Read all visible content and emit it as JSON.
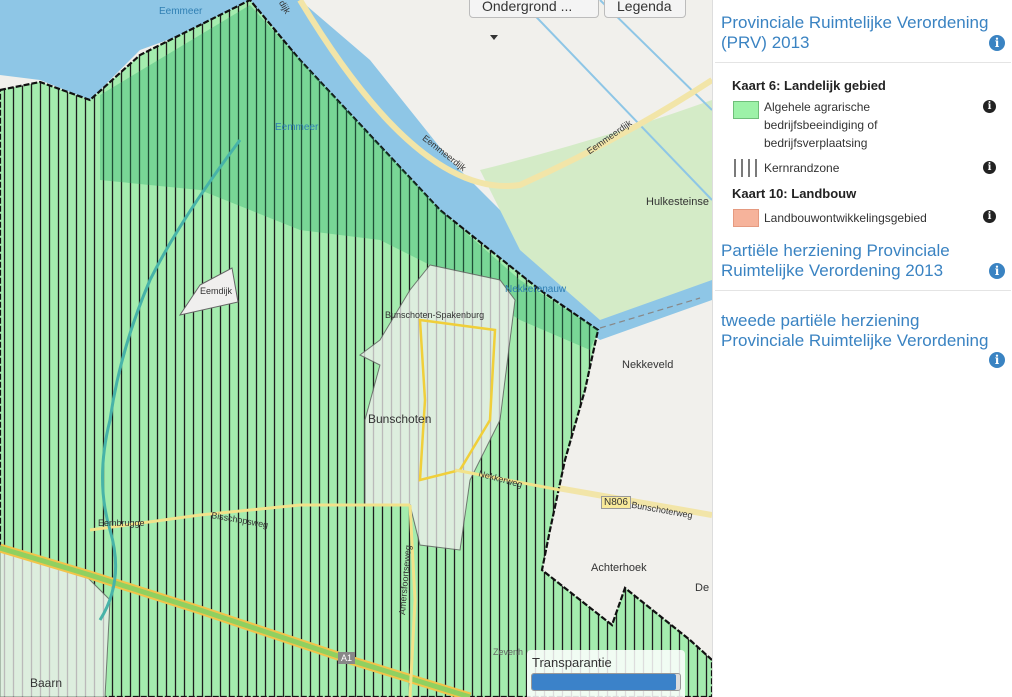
{
  "map": {
    "ondergrond_button": "Ondergrond ...",
    "legenda_button": "Legenda",
    "transparency_label": "Transparantie",
    "transparency_value": 0.97,
    "labels": {
      "eemmeer_top": "Eemmeer",
      "eemmeer_mid": "Eemmeer",
      "eemmeerdijk_a": "Eemmeerdijk",
      "eemmeerdijk_b": "Eemmeerdijk",
      "dijk": "dijk",
      "hulkesteinse": "Hulkesteinse",
      "nekkerkanaal": "Nekkerenauw",
      "nekkeveld": "Nekkeveld",
      "bunschoten_spakenburg": "Bunschoten-Spakenburg",
      "bunschoten": "Bunschoten",
      "nekkerweg": "Nekkerweg",
      "n806": "N806",
      "bunschoterweg": "Bunschoterweg",
      "bisschopsweg": "Bisschopsweg",
      "eemdijk": "Eemdijk",
      "eembrugge": "Eembrugge",
      "amersfoortseweg": "Amersfoortseweg",
      "achterhoek": "Achterhoek",
      "de": "De",
      "baarn": "Baarn",
      "a1": "A1",
      "zevenh": "Zevenh"
    }
  },
  "panel": {
    "section1_title": "Provinciale Ruimtelijke Verordening (PRV) 2013",
    "kaart6_heading": "Kaart 6: Landelijk gebied",
    "legend_items": [
      {
        "label": "Algehele agrarische bedrijfsbeeindiging of bedrijfsverplaatsing",
        "color": "#9df2a8"
      },
      {
        "label": "Kernrandzone"
      },
      {
        "label": "Landbouwontwikkelingsgebied",
        "color": "#f6b39b"
      }
    ],
    "kaart10_heading": "Kaart 10: Landbouw",
    "section2_title": "Partiële herziening Provinciale Ruimtelijke Verordening 2013",
    "section3_title": "tweede partiële herziening Provinciale Ruimtelijke Verordening",
    "info_glyph": "i"
  }
}
